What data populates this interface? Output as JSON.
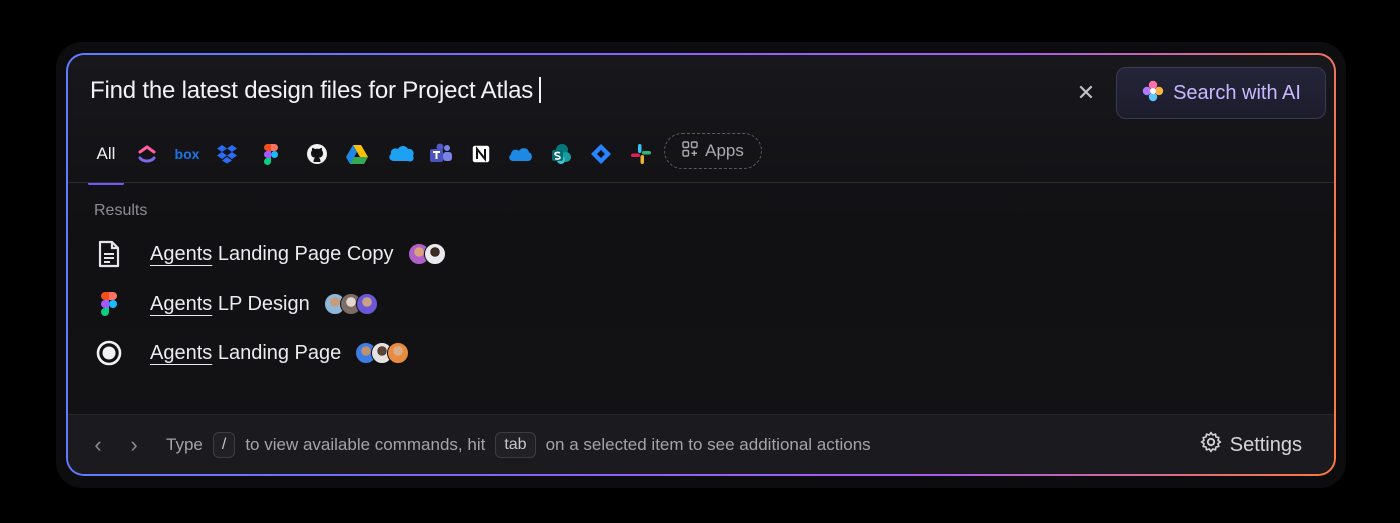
{
  "search": {
    "query": "Find the latest design files for Project Atlas",
    "clear_icon": "close-icon",
    "ai_button_label": "Search with AI"
  },
  "filters": {
    "all_label": "All",
    "sources": [
      "clickup",
      "box",
      "dropbox",
      "figma",
      "github",
      "google-drive",
      "salesforce",
      "microsoft-teams",
      "notion",
      "onedrive",
      "sharepoint",
      "jira",
      "slack"
    ],
    "apps_label": "Apps",
    "active": "All"
  },
  "results": {
    "label": "Results",
    "items": [
      {
        "highlight": "Agents",
        "rest": " Landing Page Copy",
        "icon": "document-icon",
        "avatar_count": 2
      },
      {
        "highlight": "Agents",
        "rest": " LP Design",
        "icon": "figma-icon",
        "avatar_count": 3
      },
      {
        "highlight": "Agents",
        "rest": " Landing Page",
        "icon": "record-icon",
        "avatar_count": 3
      }
    ]
  },
  "footer": {
    "type_text": "Type",
    "slash_key": "/",
    "middle_text": "to view available commands, hit",
    "tab_key": "tab",
    "end_text": "on a selected item to see additional actions",
    "settings_label": "Settings"
  },
  "colors": {
    "accent": "#6e5cf2",
    "ai_text": "#c9b8ff",
    "border_gradient": [
      "#5d7dff",
      "#a35cf0",
      "#ff7a3d"
    ]
  }
}
